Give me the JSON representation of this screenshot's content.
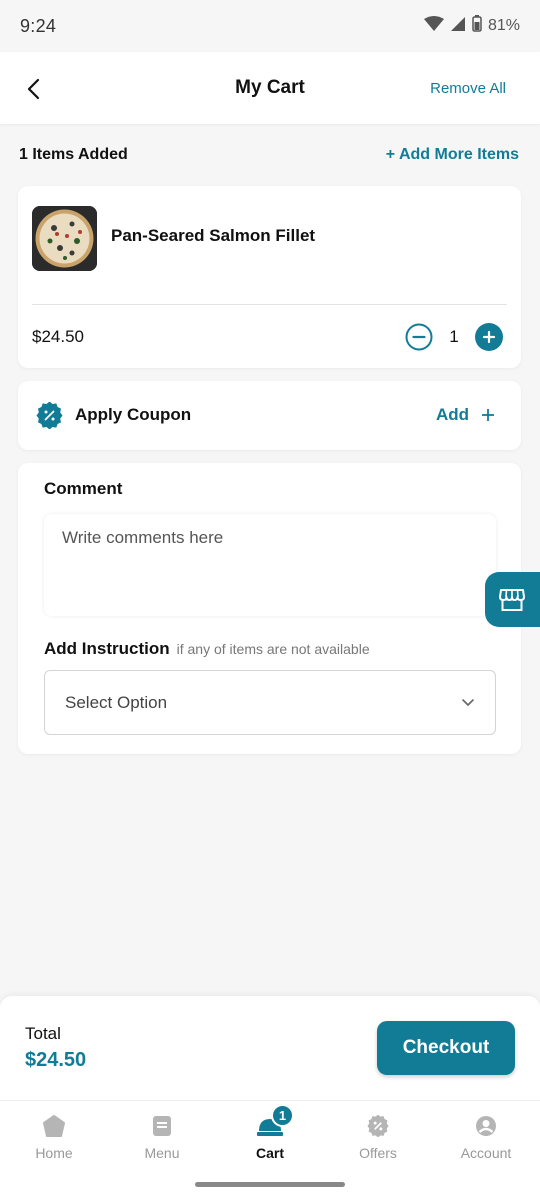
{
  "status_bar": {
    "time": "9:24",
    "battery": "81%"
  },
  "header": {
    "title": "My Cart",
    "remove_all": "Remove All"
  },
  "cart": {
    "items_count": "1 Items Added",
    "add_more": "+ Add More Items",
    "item": {
      "name": "Pan-Seared Salmon Fillet",
      "price": "$24.50",
      "quantity": "1"
    }
  },
  "coupon": {
    "label": "Apply Coupon",
    "add": "Add"
  },
  "comment": {
    "title": "Comment",
    "placeholder": "Write comments here"
  },
  "instruction": {
    "title": "Add Instruction",
    "hint": "if any of items are not available",
    "select_value": "Select Option"
  },
  "summary": {
    "total_label": "Total",
    "total_value": "$24.50",
    "checkout": "Checkout"
  },
  "nav": {
    "items": [
      {
        "label": "Home",
        "icon": "home-icon"
      },
      {
        "label": "Menu",
        "icon": "menu-icon"
      },
      {
        "label": "Cart",
        "icon": "cart-icon",
        "badge": "1",
        "active": true
      },
      {
        "label": "Offers",
        "icon": "offers-icon"
      },
      {
        "label": "Account",
        "icon": "account-icon"
      }
    ]
  },
  "colors": {
    "accent": "#127c96",
    "background": "#f6f6f7",
    "inactive_nav": "#999999"
  }
}
